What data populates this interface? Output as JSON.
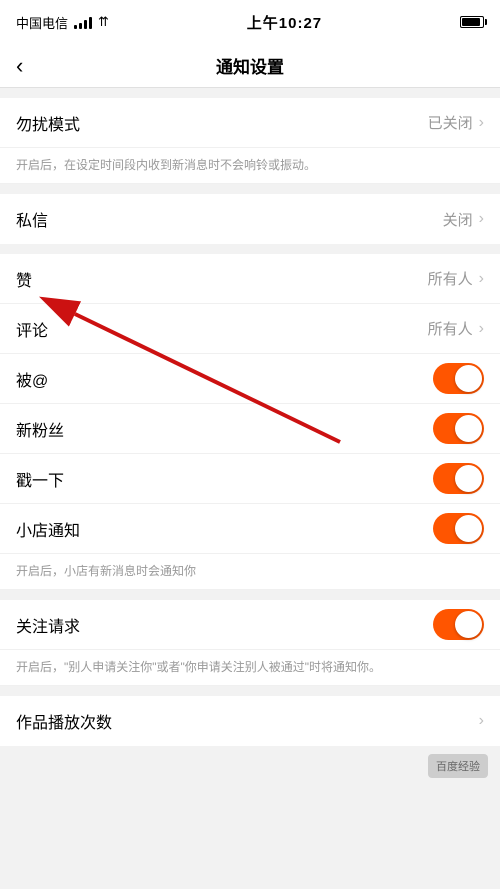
{
  "statusBar": {
    "carrier": "中国电信",
    "time": "上午10:27",
    "signalBars": [
      4,
      7,
      10,
      13
    ],
    "wifiSymbol": "▲"
  },
  "navBar": {
    "backLabel": "‹",
    "title": "通知设置"
  },
  "sections": [
    {
      "id": "dnd",
      "items": [
        {
          "label": "勿扰模式",
          "rightText": "已关闭",
          "type": "nav"
        }
      ],
      "hint": "开启后，在设定时间段内收到新消息时不会响铃或振动。"
    },
    {
      "id": "privMsg",
      "items": [
        {
          "label": "私信",
          "rightText": "关闭",
          "type": "nav"
        }
      ]
    },
    {
      "id": "interactions",
      "items": [
        {
          "label": "赞",
          "rightText": "所有人",
          "type": "nav"
        },
        {
          "label": "评论",
          "rightText": "所有人",
          "type": "nav"
        },
        {
          "label": "被@",
          "rightText": "",
          "type": "toggle",
          "toggleOn": true
        },
        {
          "label": "新粉丝",
          "rightText": "",
          "type": "toggle",
          "toggleOn": true
        },
        {
          "label": "戳一下",
          "rightText": "",
          "type": "toggle",
          "toggleOn": true
        },
        {
          "label": "小店通知",
          "rightText": "",
          "type": "toggle",
          "toggleOn": true
        }
      ],
      "hint": "开启后，小店有新消息时会通知你"
    },
    {
      "id": "follow",
      "items": [
        {
          "label": "关注请求",
          "rightText": "",
          "type": "toggle",
          "toggleOn": true
        }
      ],
      "hint": "开启后，\"别人申请关注你\"或者\"你申请关注别人被通过\"时将通知你。"
    },
    {
      "id": "plays",
      "items": [
        {
          "label": "作品播放次数",
          "rightText": "",
          "type": "nav-only"
        }
      ]
    }
  ],
  "annotation": {
    "arrowColor": "#cc0000"
  }
}
